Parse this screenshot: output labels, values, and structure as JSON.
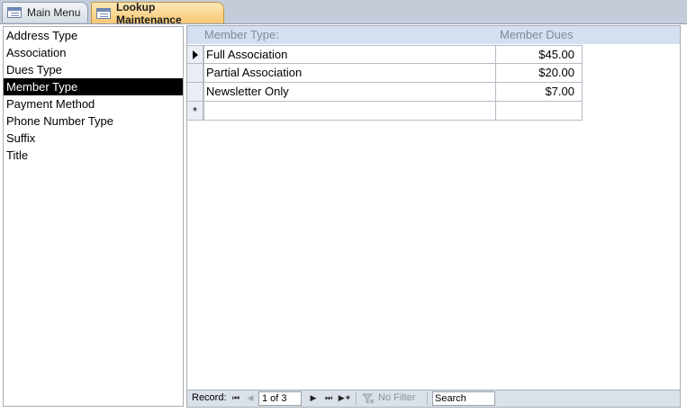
{
  "tabs": [
    {
      "label": "Main Menu",
      "active": false
    },
    {
      "label": "Lookup Maintenance",
      "active": true
    }
  ],
  "list": {
    "items": [
      "Address Type",
      "Association",
      "Dues Type",
      "Member Type",
      "Payment Method",
      "Phone Number Type",
      "Suffix",
      "Title"
    ],
    "selected": "Member Type"
  },
  "subform": {
    "headers": {
      "name": "Member Type:",
      "dues": "Member Dues"
    },
    "rows": [
      {
        "name": "Full Association",
        "dues": "$45.00",
        "current": true
      },
      {
        "name": "Partial Association",
        "dues": "$20.00"
      },
      {
        "name": "Newsletter Only",
        "dues": "$7.00"
      }
    ],
    "new_record_marker": "*"
  },
  "navbar": {
    "record_label": "Record:",
    "record_position": "1 of 3",
    "filter_label": "No Filter",
    "search_placeholder": "Search"
  },
  "colors": {
    "active_tab": "#f8c873",
    "selection": "#000000",
    "header_band": "#d4e0f0"
  }
}
